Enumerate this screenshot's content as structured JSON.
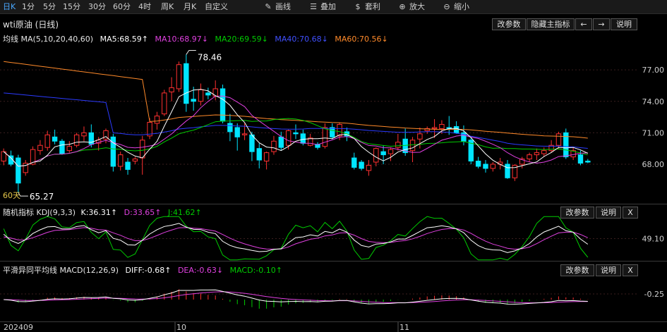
{
  "toolbar": {
    "items": [
      "日K",
      "1分",
      "5分",
      "15分",
      "30分",
      "60分",
      "4时",
      "周K",
      "月K",
      "自定义",
      "画线",
      "叠加",
      "套利",
      "放大",
      "缩小"
    ],
    "active_index": 0
  },
  "main_chart": {
    "title": "wti原油 (日线)",
    "buttons": [
      "改参数",
      "隐藏主指标",
      "←",
      "→",
      "说明"
    ],
    "ma_label": "均线 MA(5,10,20,40,60)",
    "ma5": "MA5:68.59↑",
    "ma10": "MA10:68.97↓",
    "ma20": "MA20:69.59↓",
    "ma40": "MA40:70.68↓",
    "ma60": "MA60:70.56↓",
    "high_label": "78.46",
    "low_label": "65.27",
    "period_label": "60天",
    "y_ticks": [
      "77.00",
      "74.00",
      "71.00",
      "68.00"
    ],
    "colors": {
      "ma5": "#ffffff",
      "ma10": "#e040e0",
      "ma20": "#00cc00",
      "ma40": "#2b3bff",
      "ma60": "#ff8a2a",
      "up": "#ff3030",
      "down": "#00e5ff"
    }
  },
  "kdj": {
    "label": "随机指标 KDJ(9,3,3)",
    "k": "K:36.31↑",
    "d": "D:33.65↑",
    "j": "J:41.62↑",
    "buttons": [
      "改参数",
      "说明",
      "X"
    ],
    "y_tick": "49.10"
  },
  "macd": {
    "label": "平滑异同平均线 MACD(12,26,9)",
    "diff": "DIFF:-0.68↑",
    "dea": "DEA:-0.63↓",
    "macd": "MACD:-0.10↑",
    "buttons": [
      "改参数",
      "说明",
      "X"
    ],
    "y_tick": "-0.25"
  },
  "x_axis": [
    "202409",
    "10",
    "11"
  ],
  "chart_data": {
    "type": "candlestick",
    "ohlc": [
      [
        68.3,
        69.5,
        67.9,
        69.2
      ],
      [
        68.8,
        69.3,
        67.8,
        68.0
      ],
      [
        68.6,
        68.9,
        65.3,
        66.2
      ],
      [
        67.2,
        68.4,
        66.9,
        68.1
      ],
      [
        68.0,
        69.7,
        67.9,
        69.4
      ],
      [
        69.3,
        70.3,
        68.9,
        69.8
      ],
      [
        69.6,
        71.2,
        69.3,
        70.8
      ],
      [
        70.6,
        71.3,
        69.9,
        70.2
      ],
      [
        70.2,
        70.4,
        68.9,
        69.0
      ],
      [
        69.3,
        70.2,
        69.1,
        69.7
      ],
      [
        69.8,
        71.0,
        69.6,
        70.8
      ],
      [
        70.7,
        71.6,
        70.2,
        71.0
      ],
      [
        71.0,
        71.8,
        69.6,
        69.9
      ],
      [
        70.0,
        70.6,
        69.3,
        70.3
      ],
      [
        70.4,
        71.4,
        70.0,
        71.2
      ],
      [
        70.6,
        70.9,
        67.3,
        67.8
      ],
      [
        67.8,
        69.2,
        67.4,
        68.9
      ],
      [
        68.2,
        68.6,
        67.0,
        67.5
      ],
      [
        68.3,
        68.7,
        68.0,
        68.5
      ],
      [
        68.6,
        70.7,
        67.0,
        70.3
      ],
      [
        70.7,
        72.4,
        70.4,
        72.0
      ],
      [
        71.9,
        73.0,
        71.3,
        72.6
      ],
      [
        72.8,
        75.1,
        72.6,
        74.8
      ],
      [
        74.9,
        76.3,
        74.0,
        75.3
      ],
      [
        75.2,
        77.8,
        74.9,
        77.5
      ],
      [
        77.6,
        78.46,
        73.0,
        73.8
      ],
      [
        74.2,
        75.4,
        73.1,
        74.0
      ],
      [
        74.0,
        75.7,
        73.6,
        75.1
      ],
      [
        74.8,
        75.3,
        74.2,
        74.6
      ],
      [
        74.5,
        76.0,
        74.1,
        75.2
      ],
      [
        75.2,
        75.6,
        71.9,
        72.1
      ],
      [
        71.9,
        72.8,
        70.2,
        71.1
      ],
      [
        71.5,
        71.9,
        69.3,
        70.6
      ],
      [
        70.8,
        71.9,
        70.3,
        70.9
      ],
      [
        70.8,
        71.1,
        68.3,
        69.2
      ],
      [
        69.5,
        70.0,
        67.6,
        68.4
      ],
      [
        68.3,
        69.2,
        67.5,
        69.1
      ],
      [
        69.2,
        70.7,
        68.9,
        70.2
      ],
      [
        70.6,
        71.1,
        69.3,
        69.6
      ],
      [
        69.8,
        71.3,
        69.4,
        71.2
      ],
      [
        71.0,
        71.8,
        70.4,
        70.9
      ],
      [
        70.9,
        71.3,
        69.8,
        70.0
      ],
      [
        69.8,
        70.9,
        69.7,
        70.5
      ],
      [
        69.9,
        70.1,
        69.4,
        69.6
      ],
      [
        69.7,
        71.9,
        69.5,
        71.5
      ],
      [
        71.5,
        71.9,
        70.4,
        70.6
      ],
      [
        70.7,
        72.0,
        70.3,
        71.8
      ],
      [
        71.1,
        71.5,
        70.2,
        70.7
      ],
      [
        68.6,
        69.1,
        67.5,
        67.7
      ],
      [
        68.2,
        68.4,
        67.4,
        67.6
      ],
      [
        67.4,
        68.4,
        66.9,
        67.9
      ],
      [
        68.2,
        69.6,
        67.8,
        69.5
      ],
      [
        69.2,
        69.8,
        68.0,
        68.9
      ],
      [
        69.0,
        69.6,
        68.3,
        69.4
      ],
      [
        69.6,
        70.9,
        69.3,
        70.1
      ],
      [
        70.4,
        71.4,
        68.8,
        69.1
      ],
      [
        69.3,
        70.6,
        68.2,
        70.3
      ],
      [
        70.4,
        71.5,
        69.5,
        70.9
      ],
      [
        71.2,
        71.6,
        70.9,
        71.4
      ],
      [
        71.4,
        72.3,
        70.5,
        71.5
      ],
      [
        71.4,
        72.2,
        70.9,
        71.8
      ],
      [
        71.5,
        72.6,
        70.8,
        71.4
      ],
      [
        71.6,
        72.1,
        70.9,
        71.0
      ],
      [
        71.0,
        71.7,
        69.8,
        70.2
      ],
      [
        70.3,
        70.6,
        68.0,
        68.3
      ],
      [
        68.3,
        68.7,
        67.6,
        67.8
      ],
      [
        68.0,
        68.4,
        67.2,
        67.6
      ],
      [
        67.6,
        68.2,
        67.3,
        68.0
      ],
      [
        68.0,
        68.6,
        67.5,
        68.2
      ],
      [
        68.0,
        68.4,
        66.6,
        66.7
      ],
      [
        66.7,
        68.0,
        66.4,
        67.9
      ],
      [
        68.0,
        68.7,
        67.6,
        68.5
      ],
      [
        68.5,
        69.1,
        68.2,
        68.9
      ],
      [
        68.9,
        69.5,
        68.4,
        69.1
      ],
      [
        69.0,
        69.6,
        68.7,
        69.3
      ],
      [
        69.3,
        70.3,
        69.1,
        69.8
      ],
      [
        69.8,
        71.1,
        69.5,
        70.9
      ],
      [
        71.0,
        71.4,
        68.5,
        68.7
      ],
      [
        68.7,
        69.6,
        68.4,
        69.3
      ],
      [
        68.9,
        69.3,
        67.9,
        68.1
      ],
      [
        68.3,
        68.5,
        68.1,
        68.2
      ]
    ],
    "y_range": [
      64.5,
      79.5
    ]
  }
}
